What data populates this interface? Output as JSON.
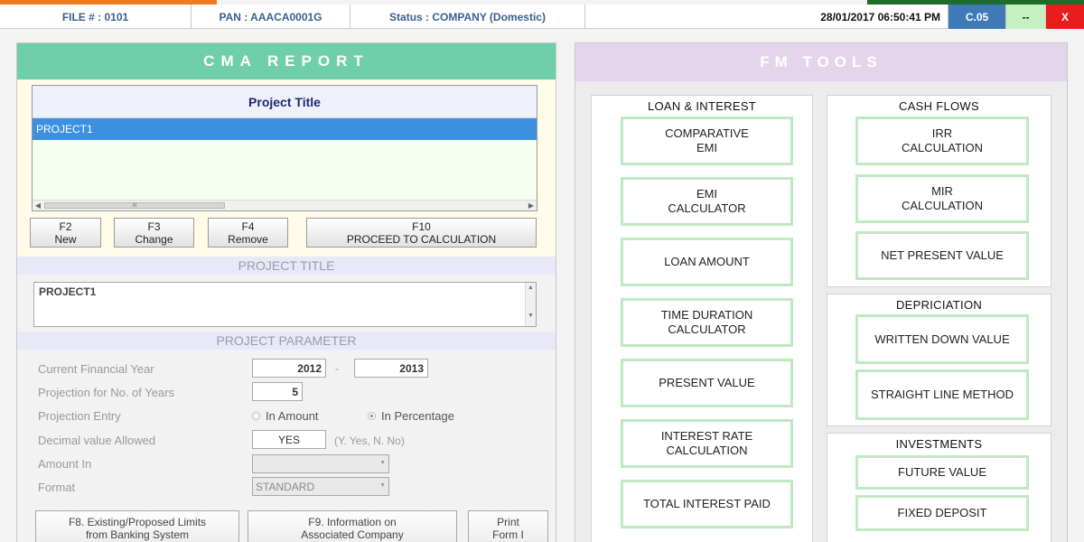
{
  "header": {
    "file": "FILE # : 0101",
    "pan": "PAN : AAACA0001G",
    "status": "Status : COMPANY (Domestic)",
    "datetime": "28/01/2017 06:50:41 PM",
    "version": "C.05",
    "minimize": "--",
    "close": "X"
  },
  "cma": {
    "title": "CMA REPORT",
    "list_header": "Project Title",
    "selected_project": "PROJECT1",
    "scroll_grip": "III",
    "buttons": [
      {
        "key": "F2",
        "label": "New"
      },
      {
        "key": "F3",
        "label": "Change"
      },
      {
        "key": "F4",
        "label": "Remove"
      },
      {
        "key": "F10",
        "label": "PROCEED TO CALCULATION"
      }
    ],
    "project_title_section": "PROJECT TITLE",
    "project_title_value": "PROJECT1",
    "project_parameter_section": "PROJECT PARAMETER",
    "fields": {
      "fy_label": "Current Financial Year",
      "fy_from": "2012",
      "fy_sep": "-",
      "fy_to": "2013",
      "years_label": "Projection for No. of Years",
      "years_value": "5",
      "entry_label": "Projection Entry",
      "entry_opt1": "In Amount",
      "entry_opt2": "In Percentage",
      "decimal_label": "Decimal value Allowed",
      "decimal_value": "YES",
      "decimal_hint": "(Y. Yes, N. No)",
      "amount_label": "Amount In",
      "amount_value": "",
      "format_label": "Format",
      "format_value": "STANDARD"
    },
    "bottom_buttons": [
      {
        "line1": "F8. Existing/Proposed Limits",
        "line2": "from Banking System"
      },
      {
        "line1": "F9. Information on",
        "line2": "Associated Company"
      },
      {
        "line1": "Print",
        "line2": "Form I"
      }
    ]
  },
  "fm": {
    "title": "FM TOOLS",
    "loan": {
      "title": "LOAN & INTEREST",
      "items": [
        {
          "l1": "COMPARATIVE",
          "l2": "EMI"
        },
        {
          "l1": "EMI",
          "l2": "CALCULATOR"
        },
        {
          "l1": "LOAN AMOUNT",
          "l2": ""
        },
        {
          "l1": "TIME DURATION",
          "l2": "CALCULATOR"
        },
        {
          "l1": "PRESENT VALUE",
          "l2": ""
        },
        {
          "l1": "INTEREST RATE",
          "l2": "CALCULATION"
        },
        {
          "l1": "TOTAL INTEREST PAID",
          "l2": ""
        }
      ]
    },
    "cash": {
      "title": "CASH FLOWS",
      "items": [
        {
          "l1": "IRR",
          "l2": "CALCULATION"
        },
        {
          "l1": "MIR",
          "l2": "CALCULATION"
        },
        {
          "l1": "NET PRESENT VALUE",
          "l2": ""
        }
      ]
    },
    "dep": {
      "title": "DEPRICIATION",
      "items": [
        {
          "l1": "WRITTEN DOWN VALUE",
          "l2": ""
        },
        {
          "l1": "STRAIGHT LINE METHOD",
          "l2": ""
        }
      ]
    },
    "inv": {
      "title": "INVESTMENTS",
      "items": [
        {
          "l1": "FUTURE VALUE",
          "l2": ""
        },
        {
          "l1": "FIXED DEPOSIT",
          "l2": ""
        }
      ]
    }
  }
}
